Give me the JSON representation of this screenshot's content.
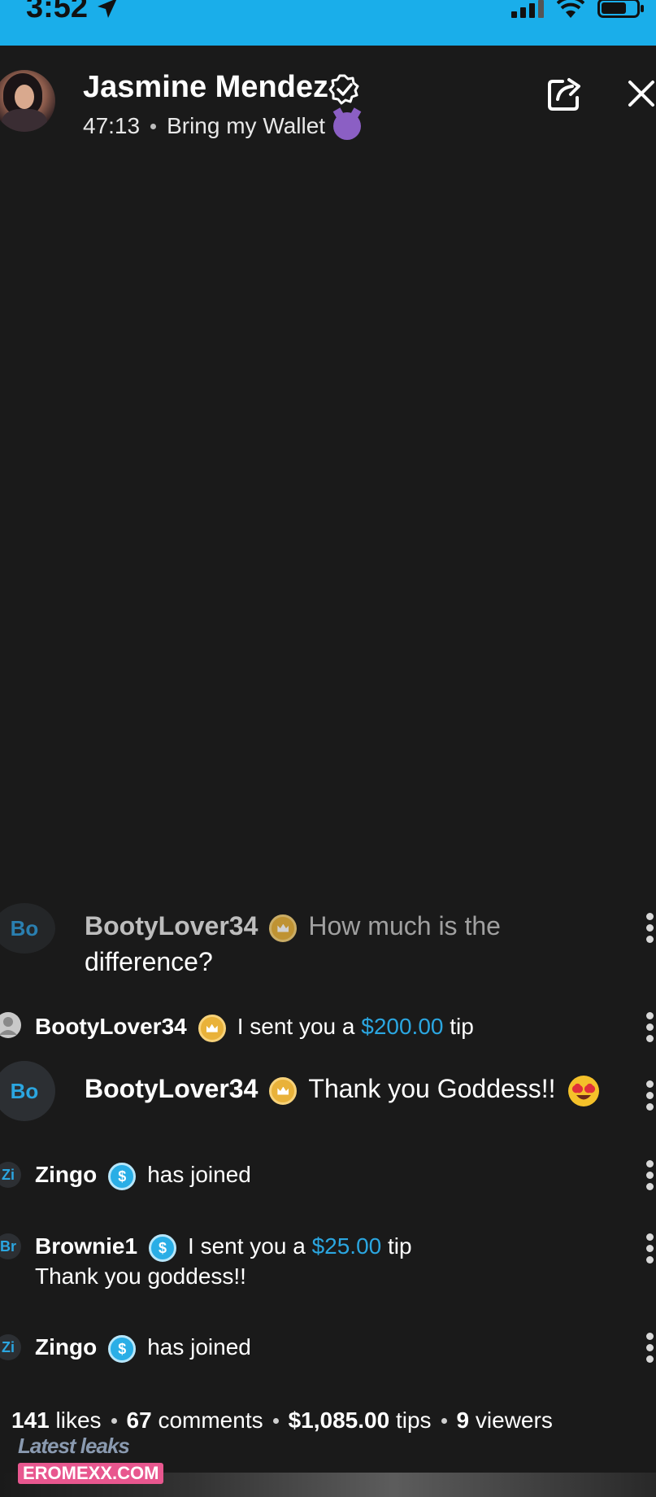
{
  "status_bar": {
    "time": "3:52",
    "bg_color": "#1aaeea"
  },
  "header": {
    "creator_name": "Jasmine Mendez",
    "elapsed": "47:13",
    "stream_title": "Bring my Wallet"
  },
  "chat": [
    {
      "avatar": "Bo",
      "user": "BootyLover34",
      "badge": "crown",
      "text": "How much is the",
      "text_line2": "difference?"
    },
    {
      "avatar": "",
      "user": "BootyLover34",
      "badge": "crown",
      "prefix": "I sent you a",
      "amount": "$200.00",
      "suffix": "tip"
    },
    {
      "avatar": "Bo",
      "user": "BootyLover34",
      "badge": "crown",
      "text": "Thank you Goddess!!"
    },
    {
      "avatar": "Zi",
      "user": "Zingo",
      "badge": "dollar",
      "text": "has joined"
    },
    {
      "avatar": "Br",
      "user": "Brownie1",
      "badge": "dollar",
      "prefix": "I sent you a",
      "amount": "$25.00",
      "suffix": "tip",
      "text_line2": "Thank you goddess!!"
    },
    {
      "avatar": "Zi",
      "user": "Zingo",
      "badge": "dollar",
      "text": "has joined"
    }
  ],
  "stats": {
    "likes_count": "141",
    "likes_label": "likes",
    "comments_count": "67",
    "comments_label": "comments",
    "tips_count": "$1,085.00",
    "tips_label": "tips",
    "viewers_count": "9",
    "viewers_label": "viewers"
  },
  "watermark": {
    "line1": "Latest leaks",
    "line2": "EROMEXX.COM"
  },
  "colors": {
    "background": "#1a1a1a",
    "accent_blue": "#2ba6e0",
    "crown_gold": "#e9b23a"
  }
}
